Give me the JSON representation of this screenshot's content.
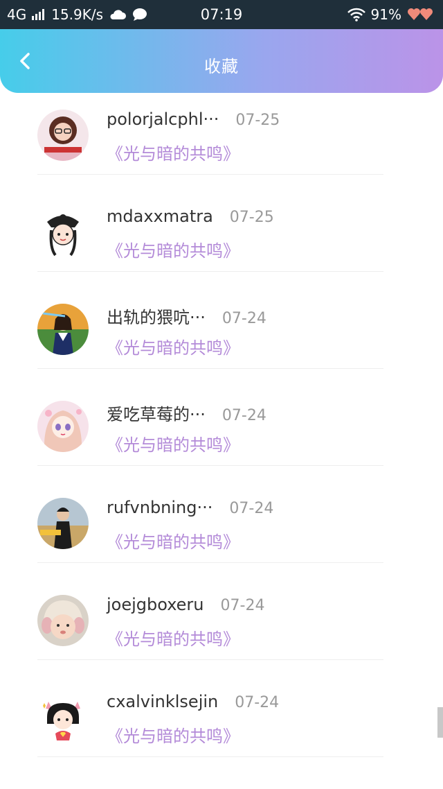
{
  "status_bar": {
    "network": "4G",
    "speed": "15.9K/s",
    "time": "07:19",
    "battery": "91%",
    "icons": [
      "signal-icon",
      "cloud-icon",
      "chat-bubble-icon",
      "wifi-icon",
      "heart-icon"
    ]
  },
  "header": {
    "title": "收藏",
    "back_icon": "chevron-left-icon",
    "gradient": [
      "#46cdea",
      "#bb93e8"
    ]
  },
  "favorites": [
    {
      "username": "polorjalcphl···",
      "date": "07-25",
      "book": "《光与暗的共鸣》",
      "avatar": "avatar-girl-glasses"
    },
    {
      "username": "mdaxxmatra",
      "date": "07-25",
      "book": "《光与暗的共鸣》",
      "avatar": "avatar-cartoon-girl"
    },
    {
      "username": "出轨的猥吭···",
      "date": "07-24",
      "book": "《光与暗的共鸣》",
      "avatar": "avatar-girl-outdoor"
    },
    {
      "username": "爱吃草莓的···",
      "date": "07-24",
      "book": "《光与暗的共鸣》",
      "avatar": "avatar-anime-girl"
    },
    {
      "username": "rufvnbning···",
      "date": "07-24",
      "book": "《光与暗的共鸣》",
      "avatar": "avatar-boy-field"
    },
    {
      "username": "joejgboxeru",
      "date": "07-24",
      "book": "《光与暗的共鸣》",
      "avatar": "avatar-baby"
    },
    {
      "username": "cxalvinklsejin",
      "date": "07-24",
      "book": "《光与暗的共鸣》",
      "avatar": "avatar-cartoon-devil-girl"
    }
  ],
  "colors": {
    "book_title": "#b38ad8",
    "username": "#333333",
    "date": "#999999"
  }
}
